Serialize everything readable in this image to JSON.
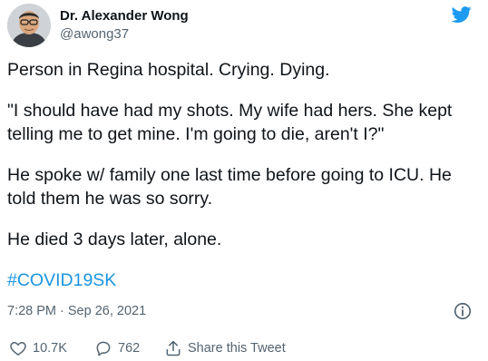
{
  "author": {
    "name": "Dr. Alexander Wong",
    "handle": "@awong37"
  },
  "tweet": {
    "paragraphs": [
      "Person in Regina hospital. Crying. Dying.",
      "\"I should have had my shots. My wife had hers. She kept telling me to get mine. I'm going to die, aren't I?\"",
      "He spoke w/ family one last time before going to ICU. He told them he was so sorry.",
      "He died 3 days later, alone."
    ],
    "hashtag": "#COVID19SK",
    "timestamp": "7:28 PM · Sep 26, 2021"
  },
  "actions": {
    "likes": "10.7K",
    "replies": "762",
    "share_label": "Share this Tweet"
  },
  "icons": {
    "brand": "twitter-bird-icon",
    "info": "info-icon",
    "like": "heart-icon",
    "reply": "reply-bubble-icon",
    "share": "share-upload-icon"
  },
  "colors": {
    "twitter_blue": "#1d9bf0",
    "hashtag_blue": "#1b95e0",
    "text_primary": "#0f1419",
    "text_secondary": "#536471"
  }
}
